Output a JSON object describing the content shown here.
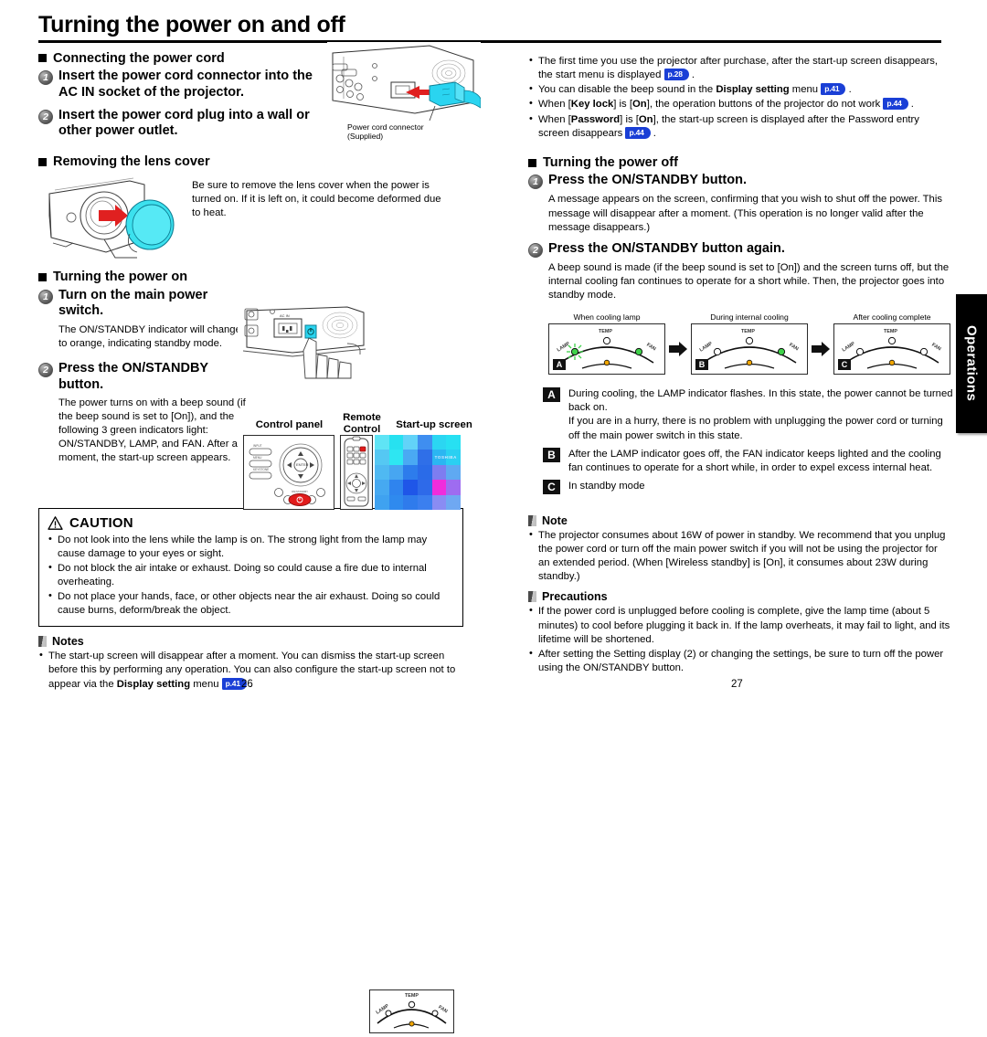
{
  "document": {
    "title": "Turning the power on and off",
    "side_tab_label": "Operations",
    "left_page_number": "26",
    "right_page_number": "27"
  },
  "left": {
    "sections": {
      "connecting": {
        "heading": "Connecting the power cord",
        "step1": "Insert the power cord connector into the AC IN socket of the projector.",
        "step1_num": "1",
        "step2": "Insert the power cord plug into a wall or other power outlet.",
        "step2_num": "2",
        "figure_caption_line1": "Power cord connector",
        "figure_caption_line2": "(Supplied)"
      },
      "lens_cover": {
        "heading": "Removing the lens cover",
        "body": "Be sure to remove the lens cover when the power is turned on. If it is left on, it could become deformed due to heat."
      },
      "power_on": {
        "heading": "Turning the power on",
        "step1_num": "1",
        "step1": "Turn on the main power switch.",
        "step1_body": "The ON/STANDBY indicator will change to orange, indicating standby mode.",
        "step2_num": "2",
        "step2": "Press the ON/STANDBY button.",
        "step2_body": "The power turns on with a beep sound (if the beep sound is set to [On]), and the following 3 green indicators light: ON/STANDBY, LAMP, and FAN. After a moment, the start-up screen appears.",
        "fig_control_panel": "Control panel",
        "fig_remote_control": "Remote Control",
        "fig_startup_screen": "Start-up screen",
        "indicator_lamp": "LAMP",
        "indicator_temp": "TEMP",
        "indicator_fan": "FAN"
      }
    },
    "caution": {
      "title": "CAUTION",
      "items": [
        "Do not look into the lens while the lamp is on.  The strong light from the lamp may cause damage to your eyes or sight.",
        "Do not block the air intake or exhaust. Doing so could cause a fire due to internal overheating.",
        "Do not place your hands, face, or other objects near the air exhaust. Doing so could cause burns, deform/break the object."
      ]
    },
    "notes": {
      "title": "Notes",
      "item_a": "The start-up screen will disappear after a moment. You can dismiss the start-up screen before this by performing any operation. You can also configure the start-up screen not to appear via the ",
      "item_a_bold": "Display setting",
      "item_a_mid": " menu ",
      "item_a_ref": "p.41",
      "item_a_end": " ."
    }
  },
  "right": {
    "top_notes": [
      {
        "pre": "The first time you use the projector after purchase, after the start-up screen disappears, the start menu is displayed ",
        "ref": "p.28",
        "post": " ."
      },
      {
        "pre": "You can disable the beep sound in the ",
        "bold": "Display setting",
        "mid": " menu ",
        "ref": "p.41",
        "post": " ."
      },
      {
        "pre": "When [",
        "bold": "Key lock",
        "mid": "] is [",
        "bold2": "On",
        "mid2": "], the operation buttons of the projector do not work ",
        "ref": "p.44",
        "post": " ."
      },
      {
        "pre": "When [",
        "bold": "Password",
        "mid": "] is [",
        "bold2": "On",
        "mid2": "], the start-up screen is displayed after the Password entry screen disappears ",
        "ref": "p.44",
        "post": " ."
      }
    ],
    "power_off": {
      "heading": "Turning the power off",
      "step1_num": "1",
      "step1": "Press the ON/STANDBY button.",
      "step1_body": "A message appears on the screen, confirming that you wish to shut off the power. This message will disappear after a moment. (This operation is no longer valid after the message disappears.)",
      "step2_num": "2",
      "step2": "Press the ON/STANDBY button again.",
      "step2_body": "A beep sound is made (if the beep sound is set to [On]) and the screen turns off, but the internal cooling fan continues to operate for a short while. Then, the projector goes into standby mode."
    },
    "cooling_figures": {
      "captions": [
        "When cooling lamp",
        "During internal cooling",
        "After cooling complete"
      ],
      "chips": [
        "A",
        "B",
        "C"
      ],
      "indicator_lamp": "LAMP",
      "indicator_temp": "TEMP",
      "indicator_fan": "FAN"
    },
    "state_descriptions": [
      {
        "chip": "A",
        "text": "During cooling, the LAMP indicator flashes. In this state, the power cannot be turned back on.\nIf you are in a hurry, there is no problem with unplugging the power cord or turning off the main power switch in this state."
      },
      {
        "chip": "B",
        "text": "After the LAMP indicator goes off, the FAN indicator keeps lighted and the cooling fan continues to operate for a short while, in order to expel excess internal heat."
      },
      {
        "chip": "C",
        "text": "In standby mode"
      }
    ],
    "note": {
      "title": "Note",
      "item": "The projector consumes about 16W of power in standby. We recommend that you unplug the power cord or turn off the main power switch if you will not be using the projector for an extended period. (When [Wireless standby] is [On], it consumes about 23W during standby.)"
    },
    "precautions": {
      "title": "Precautions",
      "items": [
        "If the power cord is unplugged before cooling is complete, give the lamp time (about 5 minutes) to cool before plugging it back in. If the lamp overheats, it may fail to light, and its lifetime will be shortened.",
        "After setting the Setting display (2) or changing the settings, be sure to turn off the power using the ON/STANDBY button."
      ]
    }
  },
  "colors": {
    "reference_badge": "#1a3fd6",
    "lens_cover_cyan": "#3ce1ee",
    "arrow_red": "#e02020",
    "connector_cyan": "#2ad4f0",
    "side_tab_bg": "#000000"
  }
}
